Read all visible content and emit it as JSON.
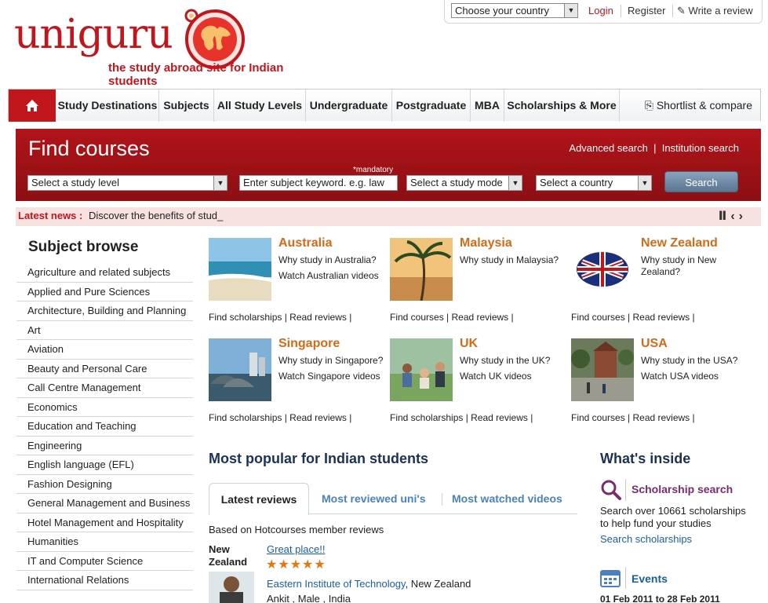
{
  "header": {
    "logo_text": "uniguru",
    "tagline": "the study abroad site for Indian students",
    "country_select": "Choose your country",
    "login": "Login",
    "register": "Register",
    "write_review": "Write a review"
  },
  "nav": {
    "items": [
      "Study Destinations",
      "Subjects",
      "All Study Levels",
      "Undergraduate",
      "Postgraduate",
      "MBA",
      "Scholarships & More"
    ],
    "shortlist": "Shortlist & compare"
  },
  "find": {
    "title": "Find courses",
    "advanced": "Advanced search",
    "sep": "|",
    "institution": "Institution search",
    "mandatory": "*mandatory",
    "level": "Select a study level",
    "keyword": "Enter subject keyword. e.g. law",
    "mode": "Select a study mode",
    "country": "Select a country",
    "search": "Search"
  },
  "news": {
    "label": "Latest news :",
    "text": "Discover the benefits of stud_"
  },
  "subjects": {
    "title": "Subject browse",
    "items": [
      "Agriculture and related subjects",
      "Applied and Pure Sciences",
      "Architecture, Building and Planning",
      "Art",
      "Aviation",
      "Beauty and Personal Care",
      "Call Centre Management",
      "Economics",
      "Education and Teaching",
      "Engineering",
      "English language (EFL)",
      "Fashion Designing",
      "General Management and Business",
      "Hotel Management and Hospitality",
      "Humanities",
      "IT and Computer Science",
      "International Relations"
    ]
  },
  "countries": [
    {
      "name": "Australia",
      "line1": "Why study in Australia?",
      "line2": "Watch Australian videos",
      "links": "Find scholarships  | Read reviews |"
    },
    {
      "name": "Malaysia",
      "line1": "Why study in Malaysia?",
      "line2": "",
      "links": "Find courses  | Read reviews |"
    },
    {
      "name": "New Zealand",
      "line1": "Why study in New Zealand?",
      "line2": "",
      "links": "Find courses  | Read reviews |"
    },
    {
      "name": "Singapore",
      "line1": "Why study in Singapore?",
      "line2": "Watch Singapore videos",
      "links": "Find scholarships | Read reviews |"
    },
    {
      "name": "UK",
      "line1": "Why study in the UK?",
      "line2": "Watch UK videos",
      "links": "Find scholarships | Read reviews |"
    },
    {
      "name": "USA",
      "line1": "Why study in the USA?",
      "line2": "Watch USA videos",
      "links": "Find courses | Read reviews |"
    }
  ],
  "popular": {
    "title": "Most popular for Indian students",
    "tabs": [
      "Latest reviews",
      "Most reviewed uni's",
      "Most watched videos"
    ],
    "based": "Based on Hotcourses member reviews",
    "review_country": "New Zealand",
    "review_title": "Great place!!",
    "stars": "★★★★★",
    "institution": "Eastern Institute of Technology",
    "institution_country": ", New Zealand",
    "person": "Ankit , Male , India"
  },
  "inside": {
    "title": "What's inside",
    "scholarship_title": "Scholarship search",
    "scholarship_desc": "Search over 10661 scholarships to help fund your studies",
    "scholarship_link": "Search scholarships",
    "events_title": "Events",
    "events_date": "01 Feb 2011 to 28 Feb 2011"
  },
  "colors": {
    "brand_red": "#c0161c",
    "country_orange": "#d46a17",
    "heading_navy": "#1b3158",
    "link_blue": "#1a5ea8"
  }
}
